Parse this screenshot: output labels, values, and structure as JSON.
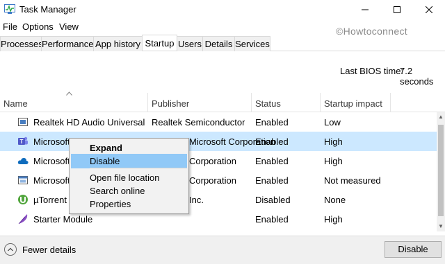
{
  "window": {
    "title": "Task Manager",
    "minimize_icon": "minimize-icon",
    "maximize_icon": "maximize-icon",
    "close_icon": "close-icon"
  },
  "menu": [
    "File",
    "Options",
    "View"
  ],
  "watermark": "©Howtoconnect",
  "tabs": [
    "Processes",
    "Performance",
    "App history",
    "Startup",
    "Users",
    "Details",
    "Services"
  ],
  "active_tab": "Startup",
  "bios": {
    "label": "Last BIOS time:",
    "value": "7.2 seconds"
  },
  "columns": [
    "Name",
    "Publisher",
    "Status",
    "Startup impact"
  ],
  "rows": [
    {
      "icon": "realtek-audio-icon",
      "name": "Realtek HD Audio Universal ...",
      "publisher": "Realtek Semiconductor",
      "status": "Enabled",
      "impact": "Low"
    },
    {
      "icon": "microsoft-teams-icon",
      "name": "Microsoft T",
      "publisher": "Microsoft Corporation",
      "status": "Enabled",
      "impact": "High"
    },
    {
      "icon": "onedrive-icon",
      "name": "Microsoft",
      "publisher": "Corporation",
      "status": "Enabled",
      "impact": "High"
    },
    {
      "icon": "app-window-icon",
      "name": "Microsoft",
      "publisher": "Corporation",
      "status": "Enabled",
      "impact": "Not measured"
    },
    {
      "icon": "utorrent-icon",
      "name": "µTorrent",
      "publisher": "Inc.",
      "status": "Disabled",
      "impact": "None"
    },
    {
      "icon": "feather-icon",
      "name": "Starter Module",
      "publisher": "",
      "status": "Enabled",
      "impact": "High"
    }
  ],
  "context_menu": {
    "items": [
      "Expand",
      "Disable",
      "Open file location",
      "Search online",
      "Properties"
    ],
    "highlighted": "Disable"
  },
  "footer": {
    "fewer_details": "Fewer details",
    "disable_button": "Disable"
  }
}
